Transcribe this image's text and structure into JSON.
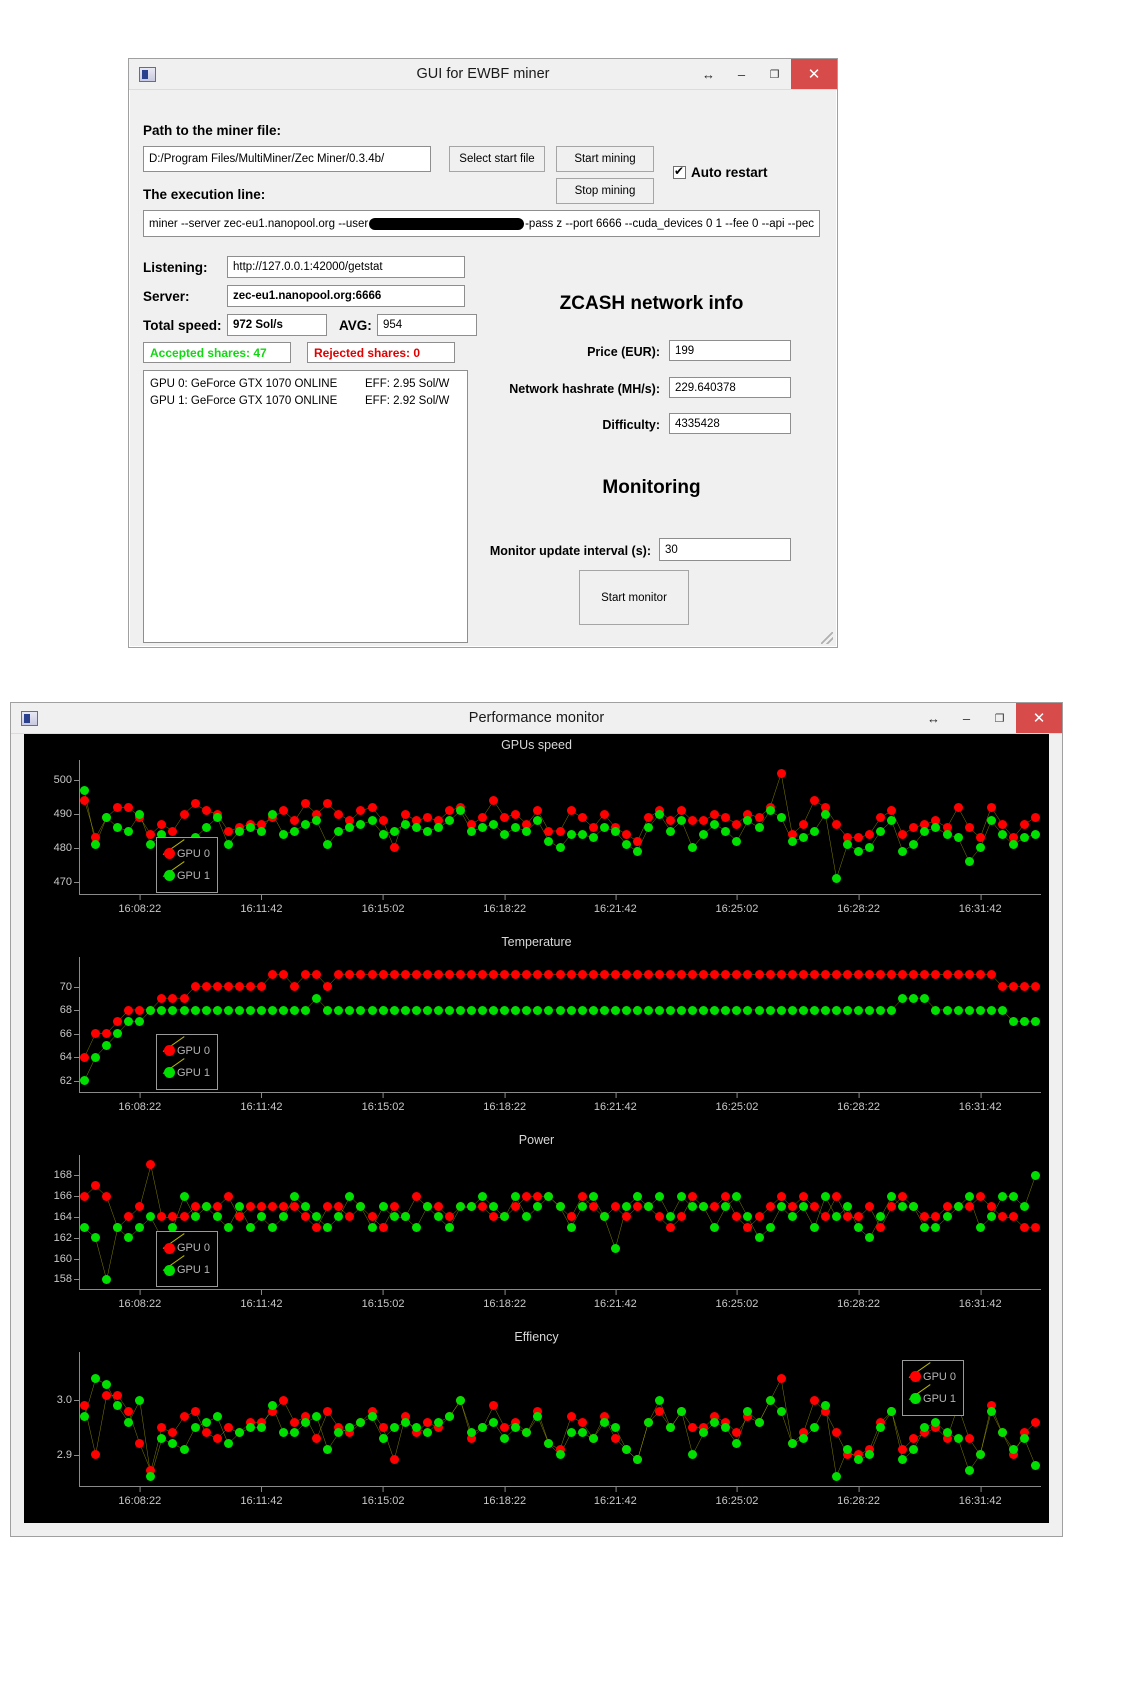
{
  "miner_window": {
    "title": "GUI for EWBF miner",
    "icon": "app-icon",
    "titlebar_buttons": {
      "resize": "↔",
      "minimize": "–",
      "maximize": "❐",
      "close": "✕"
    },
    "path_label": "Path to the miner file:",
    "path_value": "D:/Program Files/MultiMiner/Zec Miner/0.3.4b/",
    "select_start_file": "Select start file",
    "start_mining": "Start mining",
    "stop_mining": "Stop mining",
    "auto_restart_label": "Auto restart",
    "auto_restart_checked": true,
    "execution_label": "The execution line:",
    "execution_prefix": "miner --server zec-eu1.nanopool.org --user",
    "execution_suffix": "-pass z --port 6666 --cuda_devices 0 1 --fee 0 --api --pec",
    "listening_label": "Listening:",
    "listening_value": "http://127.0.0.1:42000/getstat",
    "server_label": "Server:",
    "server_value": "zec-eu1.nanopool.org:6666",
    "total_speed_label": "Total speed:",
    "total_speed_value": "972 Sol/s",
    "avg_label": "AVG:",
    "avg_value": "954",
    "accepted_shares": "Accepted shares: 47",
    "rejected_shares": "Rejected shares: 0",
    "accepted_color": "#12d712",
    "rejected_color": "#e00000",
    "gpu_rows": [
      {
        "name": "GPU 0: GeForce GTX 1070 ONLINE",
        "eff": "EFF: 2.95 Sol/W"
      },
      {
        "name": "GPU 1: GeForce GTX 1070 ONLINE",
        "eff": "EFF: 2.92 Sol/W"
      }
    ],
    "network_title": "ZCASH network info",
    "price_label": "Price (EUR):",
    "price_value": "199",
    "hashrate_label": "Network hashrate (MH/s):",
    "hashrate_value": "229.640378",
    "difficulty_label": "Difficulty:",
    "difficulty_value": "4335428",
    "monitoring_title": "Monitoring",
    "monitor_interval_label": "Monitor update interval (s):",
    "monitor_interval_value": "30",
    "start_monitor": "Start monitor"
  },
  "perf_window": {
    "title": "Performance monitor",
    "titlebar_buttons": {
      "resize": "↔",
      "minimize": "–",
      "maximize": "❐",
      "close": "✕"
    },
    "legend": {
      "gpu0": "GPU 0",
      "gpu1": "GPU 1",
      "gpu0_color": "#ff0000",
      "gpu1_color": "#00e000"
    },
    "line_color": "#b9b900",
    "x_ticks": [
      "16:08:22",
      "16:11:42",
      "16:15:02",
      "16:18:22",
      "16:21:42",
      "16:25:02",
      "16:28:22",
      "16:31:42"
    ]
  },
  "chart_data": [
    {
      "type": "line",
      "title": "GPUs speed",
      "xlabel": "",
      "ylabel": "",
      "ylim": [
        466,
        506
      ],
      "yticks": [
        470,
        480,
        490,
        500
      ],
      "xticks": [
        "16:08:22",
        "16:11:42",
        "16:15:02",
        "16:18:22",
        "16:21:42",
        "16:25:02",
        "16:28:22",
        "16:31:42"
      ],
      "legend_position": "left-inside",
      "grid": false,
      "series": [
        {
          "name": "GPU 0",
          "color": "#ff0000",
          "values": [
            494,
            483,
            489,
            492,
            492,
            489,
            484,
            487,
            485,
            490,
            493,
            491,
            490,
            485,
            486,
            487,
            487,
            489,
            491,
            488,
            493,
            490,
            493,
            490,
            488,
            491,
            492,
            488,
            480,
            490,
            488,
            489,
            488,
            491,
            492,
            487,
            489,
            494,
            489,
            490,
            487,
            491,
            485,
            485,
            491,
            489,
            486,
            490,
            486,
            484,
            482,
            489,
            491,
            488,
            491,
            488,
            488,
            490,
            489,
            487,
            490,
            489,
            492,
            502,
            484,
            487,
            494,
            492,
            487,
            483,
            483,
            484,
            489,
            491,
            484,
            486,
            487,
            488,
            486,
            492,
            486,
            483,
            492,
            487,
            483,
            487,
            489
          ]
        },
        {
          "name": "GPU 1",
          "color": "#00e000",
          "values": [
            497,
            481,
            489,
            486,
            485,
            490,
            481,
            484,
            482,
            479,
            483,
            486,
            489,
            481,
            485,
            486,
            485,
            490,
            484,
            485,
            487,
            488,
            481,
            485,
            486,
            487,
            488,
            484,
            485,
            487,
            486,
            485,
            486,
            488,
            491,
            485,
            486,
            487,
            484,
            486,
            485,
            488,
            482,
            480,
            484,
            484,
            483,
            486,
            485,
            481,
            479,
            486,
            490,
            485,
            488,
            480,
            484,
            487,
            485,
            482,
            488,
            486,
            491,
            489,
            482,
            483,
            485,
            490,
            471,
            481,
            479,
            480,
            485,
            488,
            479,
            481,
            485,
            486,
            484,
            483,
            476,
            480,
            488,
            484,
            481,
            483,
            484
          ]
        }
      ]
    },
    {
      "type": "line",
      "title": "Temperature",
      "xlabel": "",
      "ylabel": "",
      "ylim": [
        61,
        72.5
      ],
      "yticks": [
        62,
        64,
        66,
        68,
        70
      ],
      "xticks": [
        "16:08:22",
        "16:11:42",
        "16:15:02",
        "16:18:22",
        "16:21:42",
        "16:25:02",
        "16:28:22",
        "16:31:42"
      ],
      "legend_position": "left-inside",
      "grid": false,
      "series": [
        {
          "name": "GPU 0",
          "color": "#ff0000",
          "values": [
            64,
            66,
            66,
            67,
            68,
            68,
            68,
            69,
            69,
            69,
            70,
            70,
            70,
            70,
            70,
            70,
            70,
            71,
            71,
            70,
            71,
            71,
            70,
            71,
            71,
            71,
            71,
            71,
            71,
            71,
            71,
            71,
            71,
            71,
            71,
            71,
            71,
            71,
            71,
            71,
            71,
            71,
            71,
            71,
            71,
            71,
            71,
            71,
            71,
            71,
            71,
            71,
            71,
            71,
            71,
            71,
            71,
            71,
            71,
            71,
            71,
            71,
            71,
            71,
            71,
            71,
            71,
            71,
            71,
            71,
            71,
            71,
            71,
            71,
            71,
            71,
            71,
            71,
            71,
            71,
            71,
            71,
            71,
            70,
            70,
            70,
            70
          ]
        },
        {
          "name": "GPU 1",
          "color": "#00e000",
          "values": [
            62,
            64,
            65,
            66,
            67,
            67,
            68,
            68,
            68,
            68,
            68,
            68,
            68,
            68,
            68,
            68,
            68,
            68,
            68,
            68,
            68,
            69,
            68,
            68,
            68,
            68,
            68,
            68,
            68,
            68,
            68,
            68,
            68,
            68,
            68,
            68,
            68,
            68,
            68,
            68,
            68,
            68,
            68,
            68,
            68,
            68,
            68,
            68,
            68,
            68,
            68,
            68,
            68,
            68,
            68,
            68,
            68,
            68,
            68,
            68,
            68,
            68,
            68,
            68,
            68,
            68,
            68,
            68,
            68,
            68,
            68,
            68,
            68,
            68,
            69,
            69,
            69,
            68,
            68,
            68,
            68,
            68,
            68,
            68,
            67,
            67,
            67
          ]
        }
      ]
    },
    {
      "type": "line",
      "title": "Power",
      "xlabel": "",
      "ylabel": "",
      "ylim": [
        157,
        170
      ],
      "yticks": [
        158,
        160,
        162,
        164,
        166,
        168
      ],
      "xticks": [
        "16:08:22",
        "16:11:42",
        "16:15:02",
        "16:18:22",
        "16:21:42",
        "16:25:02",
        "16:28:22",
        "16:31:42"
      ],
      "legend_position": "left-inside",
      "grid": false,
      "series": [
        {
          "name": "GPU 0",
          "color": "#ff0000",
          "values": [
            166,
            167,
            166,
            163,
            164,
            165,
            169,
            164,
            164,
            164,
            165,
            165,
            165,
            166,
            164,
            165,
            165,
            165,
            165,
            165,
            164,
            163,
            165,
            165,
            164,
            165,
            164,
            163,
            165,
            164,
            166,
            165,
            165,
            164,
            165,
            165,
            165,
            164,
            164,
            165,
            166,
            166,
            166,
            165,
            164,
            166,
            165,
            164,
            165,
            164,
            165,
            165,
            164,
            163,
            164,
            166,
            165,
            165,
            166,
            164,
            163,
            164,
            165,
            166,
            165,
            166,
            165,
            164,
            166,
            164,
            164,
            165,
            163,
            165,
            166,
            165,
            164,
            164,
            165,
            165,
            165,
            166,
            165,
            164,
            164,
            163,
            163
          ]
        },
        {
          "name": "GPU 1",
          "color": "#00e000",
          "values": [
            163,
            162,
            158,
            163,
            162,
            163,
            164,
            162,
            163,
            166,
            164,
            165,
            164,
            163,
            165,
            163,
            164,
            163,
            164,
            166,
            165,
            164,
            163,
            164,
            166,
            165,
            163,
            165,
            164,
            164,
            163,
            165,
            164,
            163,
            165,
            165,
            166,
            165,
            164,
            166,
            164,
            165,
            166,
            165,
            163,
            165,
            166,
            164,
            161,
            165,
            166,
            165,
            166,
            164,
            166,
            165,
            165,
            163,
            165,
            166,
            164,
            162,
            163,
            165,
            164,
            165,
            163,
            166,
            164,
            165,
            163,
            162,
            164,
            166,
            165,
            165,
            163,
            163,
            164,
            165,
            166,
            163,
            164,
            166,
            166,
            165,
            168
          ]
        }
      ]
    },
    {
      "type": "line",
      "title": "Effiency",
      "xlabel": "",
      "ylabel": "",
      "ylim": [
        2.84,
        3.09
      ],
      "yticks": [
        2.9,
        3.0
      ],
      "xticks": [
        "16:08:22",
        "16:11:42",
        "16:15:02",
        "16:18:22",
        "16:21:42",
        "16:25:02",
        "16:28:22",
        "16:31:42"
      ],
      "legend_position": "right-inside",
      "grid": false,
      "series": [
        {
          "name": "GPU 0",
          "color": "#ff0000",
          "values": [
            2.99,
            2.9,
            3.01,
            3.01,
            2.98,
            2.92,
            2.87,
            2.95,
            2.94,
            2.97,
            2.98,
            2.94,
            2.93,
            2.95,
            2.94,
            2.96,
            2.96,
            2.98,
            3.0,
            2.96,
            2.97,
            2.93,
            2.98,
            2.95,
            2.94,
            2.96,
            2.98,
            2.95,
            2.89,
            2.97,
            2.94,
            2.96,
            2.95,
            2.97,
            3.0,
            2.93,
            2.95,
            2.99,
            2.95,
            2.96,
            2.94,
            2.98,
            2.92,
            2.91,
            2.97,
            2.96,
            2.93,
            2.97,
            2.93,
            2.91,
            2.89,
            2.96,
            2.98,
            2.95,
            2.98,
            2.95,
            2.95,
            2.97,
            2.96,
            2.94,
            2.97,
            2.96,
            3.0,
            3.04,
            2.92,
            2.94,
            3.0,
            2.98,
            2.94,
            2.9,
            2.9,
            2.91,
            2.96,
            2.98,
            2.91,
            2.93,
            2.94,
            2.95,
            2.93,
            2.99,
            2.93,
            2.9,
            2.99,
            2.94,
            2.9,
            2.94,
            2.96
          ]
        },
        {
          "name": "GPU 1",
          "color": "#00e000",
          "values": [
            2.97,
            3.04,
            3.03,
            2.99,
            2.96,
            3.0,
            2.86,
            2.93,
            2.92,
            2.91,
            2.95,
            2.96,
            2.97,
            2.92,
            2.94,
            2.95,
            2.95,
            2.99,
            2.94,
            2.94,
            2.96,
            2.97,
            2.91,
            2.94,
            2.95,
            2.96,
            2.97,
            2.93,
            2.95,
            2.96,
            2.95,
            2.94,
            2.96,
            2.97,
            3.0,
            2.94,
            2.95,
            2.96,
            2.93,
            2.95,
            2.94,
            2.97,
            2.92,
            2.9,
            2.94,
            2.94,
            2.93,
            2.96,
            2.95,
            2.91,
            2.89,
            2.96,
            3.0,
            2.95,
            2.98,
            2.9,
            2.94,
            2.96,
            2.95,
            2.92,
            2.98,
            2.96,
            3.0,
            2.98,
            2.92,
            2.93,
            2.95,
            2.99,
            2.86,
            2.91,
            2.89,
            2.9,
            2.95,
            2.98,
            2.89,
            2.91,
            2.95,
            2.96,
            2.94,
            2.93,
            2.87,
            2.9,
            2.98,
            2.94,
            2.91,
            2.93,
            2.88
          ]
        }
      ]
    }
  ]
}
